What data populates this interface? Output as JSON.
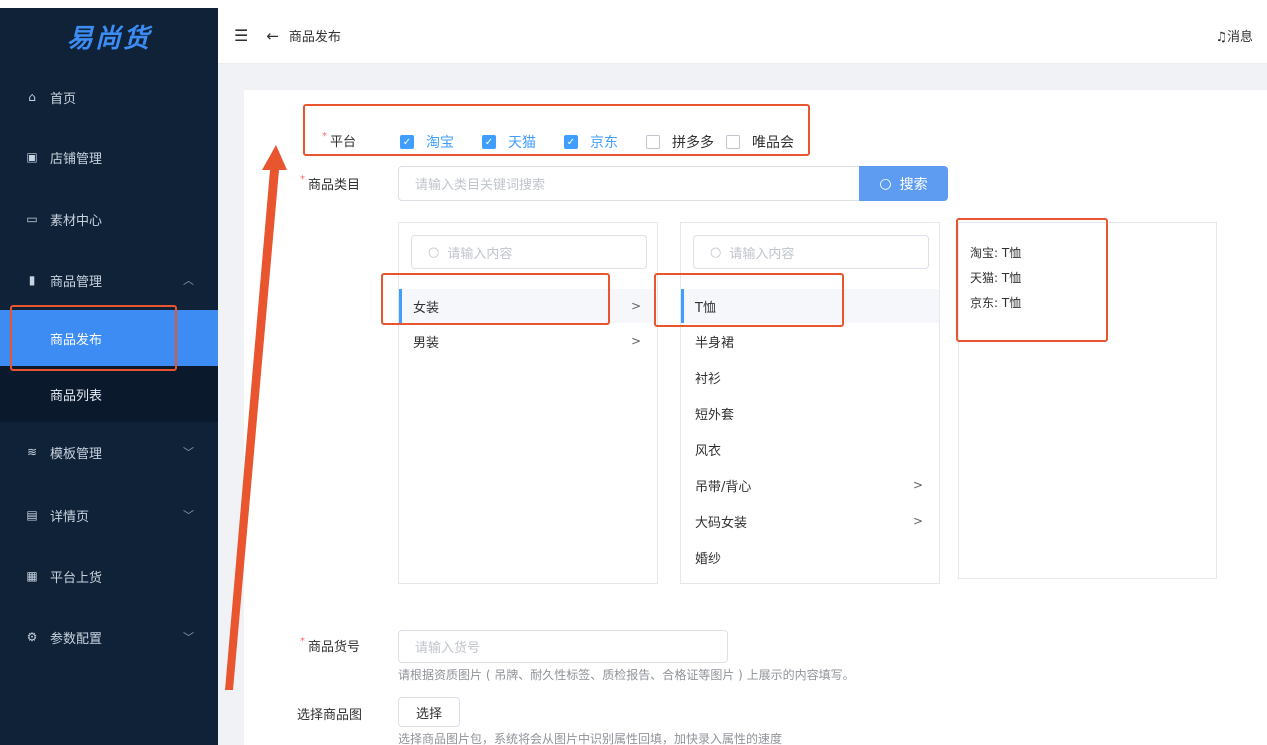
{
  "app": {
    "logo": "易尚货"
  },
  "sidebar": {
    "items": [
      {
        "label": "首页",
        "icon": "home-icon"
      },
      {
        "label": "店铺管理",
        "icon": "store-icon"
      },
      {
        "label": "素材中心",
        "icon": "image-icon"
      },
      {
        "label": "商品管理",
        "icon": "chart-icon",
        "expanded": true
      },
      {
        "label": "模板管理",
        "icon": "layers-icon"
      },
      {
        "label": "详情页",
        "icon": "doc-icon"
      },
      {
        "label": "平台上货",
        "icon": "calendar-icon"
      },
      {
        "label": "参数配置",
        "icon": "gear-icon"
      }
    ],
    "submenu": [
      {
        "label": "商品发布",
        "active": true
      },
      {
        "label": "商品列表",
        "active": false
      }
    ]
  },
  "header": {
    "title": "商品发布",
    "message": "消息"
  },
  "form": {
    "platform_label": "平台",
    "platforms": [
      {
        "label": "淘宝",
        "checked": true
      },
      {
        "label": "天猫",
        "checked": true
      },
      {
        "label": "京东",
        "checked": true
      },
      {
        "label": "拼多多",
        "checked": false
      },
      {
        "label": "唯品会",
        "checked": false
      }
    ],
    "category_label": "商品类目",
    "category_placeholder": "请输入类目关键词搜索",
    "search_button": "搜索",
    "panel_placeholder": "请输入内容",
    "level1": [
      {
        "label": "女装",
        "selected": true,
        "has_children": true
      },
      {
        "label": "男装",
        "selected": false,
        "has_children": true
      }
    ],
    "level2": [
      {
        "label": "T恤",
        "selected": true,
        "has_children": false
      },
      {
        "label": "半身裙",
        "selected": false,
        "has_children": false
      },
      {
        "label": "衬衫",
        "selected": false,
        "has_children": false
      },
      {
        "label": "短外套",
        "selected": false,
        "has_children": false
      },
      {
        "label": "风衣",
        "selected": false,
        "has_children": false
      },
      {
        "label": "吊带/背心",
        "selected": false,
        "has_children": true
      },
      {
        "label": "大码女装",
        "selected": false,
        "has_children": true
      },
      {
        "label": "婚纱",
        "selected": false,
        "has_children": false
      }
    ],
    "results": [
      "淘宝: T恤",
      "天猫: T恤",
      "京东: T恤"
    ],
    "sku_label": "商品货号",
    "sku_placeholder": "请输入货号",
    "sku_hint": "请根据资质图片 ( 吊牌、耐久性标签、质检报告、合格证等图片 ) 上展示的内容填写。",
    "image_label": "选择商品图",
    "choose_button": "选择",
    "image_hint": "选择商品图片包，系统将会从图片中识别属性回填，加快录入属性的速度"
  },
  "colors": {
    "sidebar_bg": "#0f2238",
    "accent": "#409eff",
    "annotation": "#e8552e"
  }
}
